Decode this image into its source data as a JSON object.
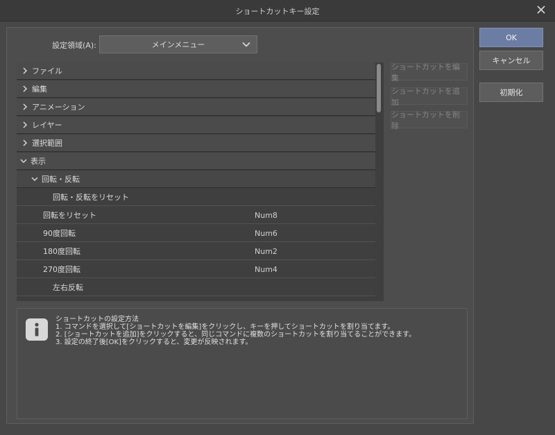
{
  "window": {
    "title": "ショートカットキー設定"
  },
  "area": {
    "label": "設定領域(A):",
    "value": "メインメニュー"
  },
  "tree": [
    {
      "label": "ファイル",
      "key": ""
    },
    {
      "label": "編集",
      "key": ""
    },
    {
      "label": "アニメーション",
      "key": ""
    },
    {
      "label": "レイヤー",
      "key": ""
    },
    {
      "label": "選択範囲",
      "key": ""
    },
    {
      "label": "表示",
      "key": ""
    },
    {
      "label": "回転・反転",
      "key": ""
    },
    {
      "label": "回転・反転をリセット",
      "key": ""
    },
    {
      "label": "回転をリセット",
      "key": "Num8"
    },
    {
      "label": "90度回転",
      "key": "Num6"
    },
    {
      "label": "180度回転",
      "key": "Num2"
    },
    {
      "label": "270度回転",
      "key": "Num4"
    },
    {
      "label": "左右反転",
      "key": ""
    }
  ],
  "actions": {
    "edit": "ショートカットを編集",
    "add": "ショートカットを追加",
    "delete": "ショートカットを削除"
  },
  "dialog": {
    "ok": "OK",
    "cancel": "キャンセル",
    "reset": "初期化"
  },
  "info": {
    "title": "ショートカットの設定方法",
    "line1": "1. コマンドを選択して[ショートカットを編集]をクリックし、キーを押してショートカットを割り当てます。",
    "line2": "2. [ショートカットを追加]をクリックすると、同じコマンドに複数のショートカットを割り当てることができます。",
    "line3": "3. 設定の終了後[OK]をクリックすると、変更が反映されます。"
  }
}
